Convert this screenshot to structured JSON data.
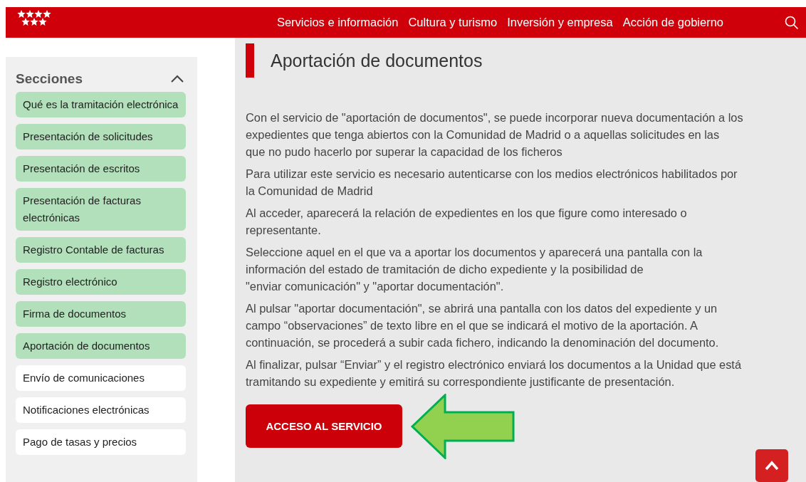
{
  "header": {
    "nav": [
      "Servicios e información",
      "Cultura y turismo",
      "Inversión y empresa",
      "Acción de gobierno"
    ]
  },
  "sidebar": {
    "title": "Secciones",
    "expanded": true,
    "items": [
      {
        "label": "Qué es la tramitación electrónica",
        "highlighted": true
      },
      {
        "label": "Presentación de solicitudes",
        "highlighted": true
      },
      {
        "label": "Presentación de escritos",
        "highlighted": true
      },
      {
        "label": "Presentación de facturas electrónicas",
        "highlighted": true
      },
      {
        "label": "Registro Contable de facturas",
        "highlighted": true
      },
      {
        "label": "Registro electrónico",
        "highlighted": true
      },
      {
        "label": "Firma de documentos",
        "highlighted": true
      },
      {
        "label": "Aportación de documentos",
        "highlighted": true
      },
      {
        "label": "Envío de comunicaciones",
        "highlighted": false
      },
      {
        "label": "Notificaciones electrónicas",
        "highlighted": false
      },
      {
        "label": "Pago de tasas y precios",
        "highlighted": false
      }
    ]
  },
  "main": {
    "title": "Aportación de documentos",
    "paragraphs": [
      [
        "Con el servicio de \"aportación de documentos\", se puede incorporar nueva documentación a los",
        "expedientes que tenga abiertos con la Comunidad de Madrid o a aquellas solicitudes en las",
        "que no pudo hacerlo por superar la capacidad de los ficheros"
      ],
      [
        "Para utilizar este servicio es necesario autenticarse con los medios electrónicos habilitados por",
        "la Comunidad de Madrid"
      ],
      [
        "Al acceder, aparecerá la relación de expedientes en los que figure como interesado o",
        "representante."
      ],
      [
        "Seleccione aquel en el que va a aportar los documentos y aparecerá una pantalla con la",
        "información del estado de tramitación de dicho expediente y la posibilidad de",
        "\"enviar comunicación\" y \"aportar documentación\"."
      ],
      [
        "Al pulsar \"aportar documentación\", se abrirá una pantalla con los datos del expediente y un",
        "campo “observaciones” de texto libre en el que se indicará el motivo de la aportación. A",
        "continuación, se procederá a subir cada fichero, indicando la denominación del documento."
      ],
      [
        "Al finalizar, pulsar “Enviar” y el registro electrónico enviará los documentos a la Unidad que está",
        "tramitando su expediente y emitirá su correspondiente justificante de presentación."
      ]
    ],
    "button": "ACCESO AL SERVICIO"
  }
}
